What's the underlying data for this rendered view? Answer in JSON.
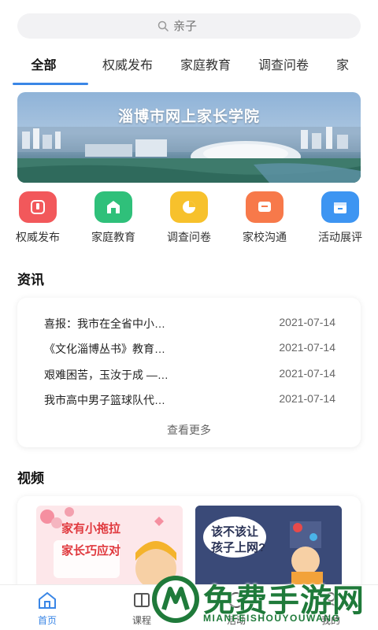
{
  "search": {
    "placeholder": "亲子"
  },
  "tabs": [
    {
      "label": "全部"
    },
    {
      "label": "权威发布"
    },
    {
      "label": "家庭教育"
    },
    {
      "label": "调查问卷"
    },
    {
      "label": "家"
    }
  ],
  "banner": {
    "title": "淄博市网上家长学院"
  },
  "quick_links": [
    {
      "label": "权威发布",
      "color": "#f2585b",
      "icon": "megaphone-icon"
    },
    {
      "label": "家庭教育",
      "color": "#2fc07a",
      "icon": "home-icon"
    },
    {
      "label": "调查问卷",
      "color": "#f7c12c",
      "icon": "pie-chart-icon"
    },
    {
      "label": "家校沟通",
      "color": "#f7794a",
      "icon": "chat-icon"
    },
    {
      "label": "活动展评",
      "color": "#3d95f2",
      "icon": "calendar-icon"
    }
  ],
  "news": {
    "section_title": "资讯",
    "items": [
      {
        "title": "喜报：我市在全省中小…",
        "date": "2021-07-14"
      },
      {
        "title": "《文化淄博丛书》教育…",
        "date": "2021-07-14"
      },
      {
        "title": "艰难困苦，玉汝于成 —…",
        "date": "2021-07-14"
      },
      {
        "title": "我市高中男子篮球队代…",
        "date": "2021-07-14"
      }
    ],
    "more_label": "查看更多"
  },
  "videos": {
    "section_title": "视频",
    "items": [
      {
        "caption_line1": "家有小拖拉",
        "caption_line2": "家长巧应对"
      },
      {
        "caption_line1": "该不该让",
        "caption_line2": "孩子上网?"
      }
    ]
  },
  "tabbar": [
    {
      "label": "首页",
      "active": true
    },
    {
      "label": "课程",
      "active": false
    },
    {
      "label": "活动",
      "active": false
    },
    {
      "label": "我的",
      "active": false
    }
  ],
  "watermark": {
    "big": "免费手游网",
    "small": "MIANFEISHOUYOUWANG"
  },
  "colors": {
    "accent": "#3a86e6",
    "watermark": "#1f7a3a"
  }
}
